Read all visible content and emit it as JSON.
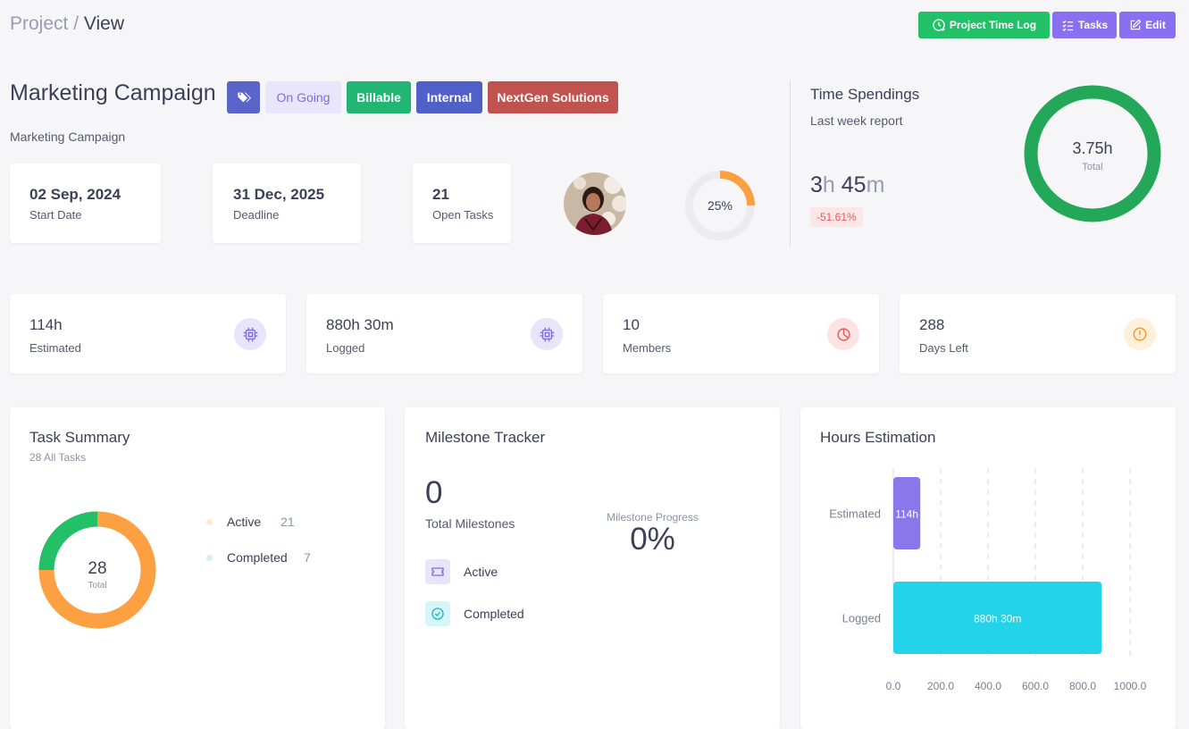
{
  "breadcrumb": {
    "parent": "Project",
    "separator": " / ",
    "current": "View"
  },
  "toolbar": {
    "time_log": "Project Time Log",
    "tasks": "Tasks",
    "edit": "Edit"
  },
  "project": {
    "title": "Marketing Campaign",
    "subtitle": "Marketing Campaign",
    "badges": {
      "status": "On Going",
      "billable": "Billable",
      "internal": "Internal",
      "client": "NextGen Solutions"
    }
  },
  "dates": [
    {
      "value": "02 Sep, 2024",
      "label": "Start Date"
    },
    {
      "value": "31 Dec, 2025",
      "label": "Deadline"
    },
    {
      "value": "21",
      "label": "Open Tasks"
    }
  ],
  "progress": {
    "percent": 25,
    "label": "25%"
  },
  "time_spendings": {
    "title": "Time Spendings",
    "subtitle": "Last week report",
    "hours": "3",
    "hours_unit": "h",
    "minutes": "45",
    "minutes_unit": "m",
    "change": "-51.61%",
    "donut_value": "3.75h",
    "donut_label": "Total"
  },
  "kpis": [
    {
      "value": "114h",
      "label": "Estimated",
      "icon": "cpu-icon"
    },
    {
      "value": "880h 30m",
      "label": "Logged",
      "icon": "cpu-icon"
    },
    {
      "value": "10",
      "label": "Members",
      "icon": "pie-chart-icon"
    },
    {
      "value": "288",
      "label": "Days Left",
      "icon": "alert-circle-icon"
    }
  ],
  "task_summary": {
    "title": "Task Summary",
    "subtitle": "28 All Tasks",
    "total": "28",
    "total_label": "Total",
    "legend": [
      {
        "label": "Active",
        "count": "21"
      },
      {
        "label": "Completed",
        "count": "7"
      }
    ]
  },
  "milestones": {
    "title": "Milestone Tracker",
    "total": "0",
    "total_label": "Total Milestones",
    "progress_label": "Milestone Progress",
    "progress_value": "0%",
    "items": [
      {
        "label": "Active",
        "icon": "ticket-icon"
      },
      {
        "label": "Completed",
        "icon": "check-circle-icon"
      }
    ]
  },
  "colors": {
    "green": "#22b573",
    "purple": "#7b6cf0",
    "indigo": "#5060c8",
    "red": "#c0524f",
    "orange": "#fda042",
    "cyan": "#22d3ea",
    "donut_green": "#23a859"
  },
  "chart_data": {
    "type": "bar",
    "orientation": "horizontal",
    "title": "Hours Estimation",
    "categories": [
      "Estimated",
      "Logged"
    ],
    "values": [
      114,
      880.5
    ],
    "value_labels": [
      "114h",
      "880h 30m"
    ],
    "xlim": [
      0,
      1000
    ],
    "x_ticks": [
      "0.0",
      "200.0",
      "400.0",
      "600.0",
      "800.0",
      "1000.0"
    ],
    "grid": true,
    "colors": [
      "#8a78ea",
      "#22d3ea"
    ]
  }
}
